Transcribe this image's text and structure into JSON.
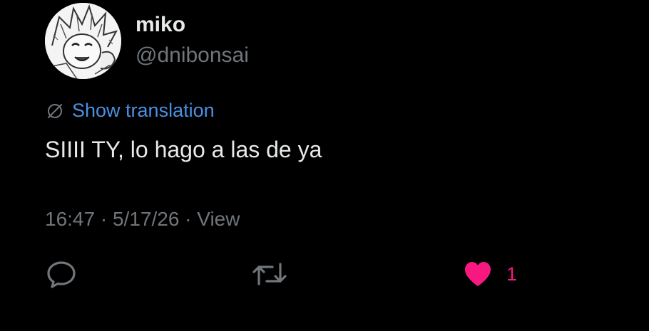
{
  "user": {
    "display_name": "miko",
    "handle": "@dnibonsai"
  },
  "translation": {
    "label": "Show translation"
  },
  "tweet": {
    "text": "SIIII TY, lo hago a las de ya"
  },
  "meta": {
    "time": "16:47",
    "separator": " · ",
    "date": "5/17/26",
    "views_label": "View"
  },
  "actions": {
    "like_count": "1"
  },
  "colors": {
    "background": "#000000",
    "text": "#e7e9ea",
    "muted": "#71767b",
    "link": "#4a90e2",
    "like": "#f91880"
  },
  "icons": {
    "translate": "globe-slash-icon",
    "reply": "speech-bubble-icon",
    "retweet": "retweet-arrows-icon",
    "like": "heart-filled-icon"
  }
}
